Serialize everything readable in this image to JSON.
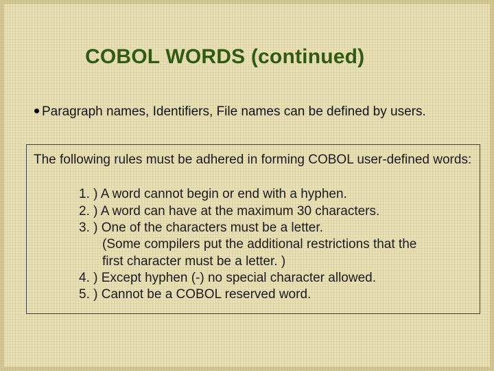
{
  "title": "COBOL WORDS (continued)",
  "bullet": "Paragraph names, Identifiers, File names can be defined by users.",
  "rules_intro": "The following rules must be adhered in forming COBOL user-defined words:",
  "rules": [
    {
      "num": "1. )",
      "text": "A word cannot begin or end with a hyphen."
    },
    {
      "num": "2. )",
      "text": "A word can have at the maximum 30 characters."
    },
    {
      "num": "3. )",
      "text": "One of the characters must be a letter.",
      "sub": [
        "(Some compilers put the additional restrictions that the",
        "first character must be a letter. )"
      ]
    },
    {
      "num": "4. )",
      "text": "Except hyphen (-) no special character allowed."
    },
    {
      "num": "5. )",
      "text": "Cannot be a COBOL reserved word."
    }
  ]
}
